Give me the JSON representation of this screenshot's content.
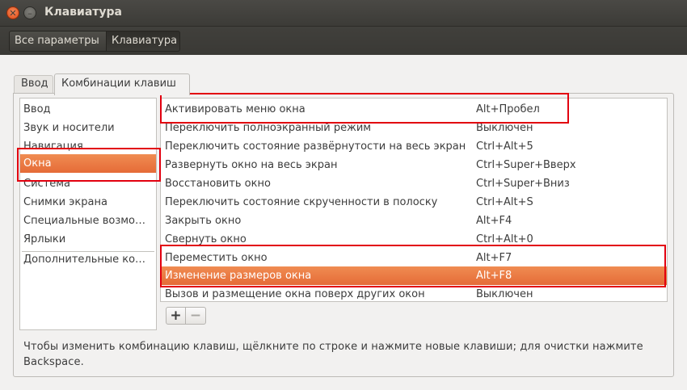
{
  "window": {
    "title": "Клавиатура"
  },
  "breadcrumb": {
    "all_settings": "Все параметры",
    "keyboard": "Клавиатура"
  },
  "tabs": [
    {
      "label": "Ввод"
    },
    {
      "label": "Комбинации клавиш"
    }
  ],
  "categories": [
    {
      "label": "Ввод"
    },
    {
      "label": "Звук и носители"
    },
    {
      "label": "Навигация"
    },
    {
      "label": "Окна"
    },
    {
      "label": "Система"
    },
    {
      "label": "Снимки экрана"
    },
    {
      "label": "Специальные возмо…"
    },
    {
      "label": "Ярлыки"
    },
    {
      "label": "Дополнительные ко…"
    }
  ],
  "shortcuts": [
    {
      "name": "Активировать меню окна",
      "key": "Alt+Пробел"
    },
    {
      "name": "Переключить полноэкранный режим",
      "key": "Выключен"
    },
    {
      "name": "Переключить состояние развёрнутости на весь экран",
      "key": "Ctrl+Alt+5"
    },
    {
      "name": "Развернуть окно на весь экран",
      "key": "Ctrl+Super+Вверх"
    },
    {
      "name": "Восстановить окно",
      "key": "Ctrl+Super+Вниз"
    },
    {
      "name": "Переключить состояние скрученности в полоску",
      "key": "Ctrl+Alt+S"
    },
    {
      "name": "Закрыть окно",
      "key": "Alt+F4"
    },
    {
      "name": "Свернуть окно",
      "key": "Ctrl+Alt+0"
    },
    {
      "name": "Переместить окно",
      "key": "Alt+F7"
    },
    {
      "name": "Изменение размеров окна",
      "key": "Alt+F8"
    },
    {
      "name": "Вызов и размещение окна поверх других окон",
      "key": "Выключен"
    }
  ],
  "buttons": {
    "add": "+",
    "remove": "−"
  },
  "hint": "Чтобы изменить комбинацию клавиш, щёлкните по строке и нажмите новые клавиши; для очистки нажмите Backspace.",
  "colors": {
    "selection": "#e8703a",
    "annotation": "#e2000f",
    "titlebar": "#3c3b37"
  }
}
